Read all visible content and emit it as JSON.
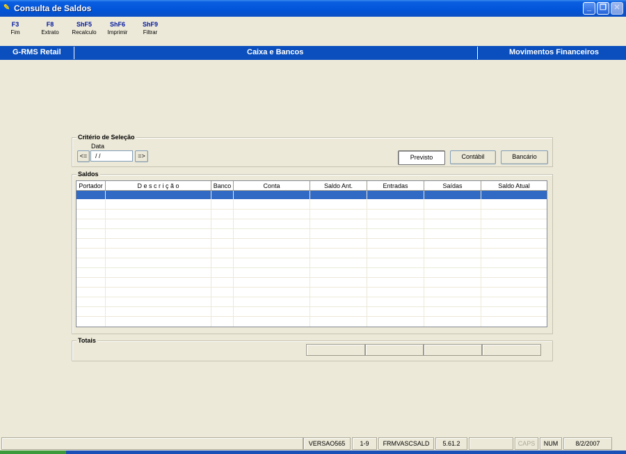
{
  "window": {
    "title": "Consulta de Saldos",
    "icon": "app-icon"
  },
  "toolbar": {
    "items": [
      {
        "key": "F3",
        "label": "Fim"
      },
      {
        "key": "F8",
        "label": "Extrato"
      },
      {
        "key": "ShF5",
        "label": "Recalculo"
      },
      {
        "key": "ShF6",
        "label": "Imprimir"
      },
      {
        "key": "ShF9",
        "label": "Filtrar"
      }
    ]
  },
  "header_bar": {
    "left": "G-RMS Retail",
    "center": "Caixa e Bancos",
    "right": "Movimentos Financeiros"
  },
  "criteria": {
    "title": "Critério de Seleção",
    "date_label": "Data",
    "prev_button": "<=",
    "next_button": "=>",
    "date_value": "/ /",
    "buttons": {
      "previsto": "Previsto",
      "contabil": "Contábil",
      "bancario": "Bancário"
    }
  },
  "saldos": {
    "title": "Saldos",
    "columns": [
      "Portador",
      "D e s c r i ç ã o",
      "Banco",
      "Conta",
      "Saldo Ant.",
      "Entradas",
      "Saídas",
      "Saldo Atual"
    ],
    "rows": []
  },
  "totais": {
    "title": "Totais"
  },
  "statusbar": {
    "version": "VERSAO565",
    "page": "1-9",
    "form": "FRMVASCSALD",
    "build": "5.61.2",
    "caps": "CAPS",
    "num": "NUM",
    "date": "8/2/2007"
  },
  "colors": {
    "title_bar": "#0a5ee0",
    "header_bar": "#0a4fbd",
    "selection": "#316ac5",
    "key_text": "#00169d"
  }
}
